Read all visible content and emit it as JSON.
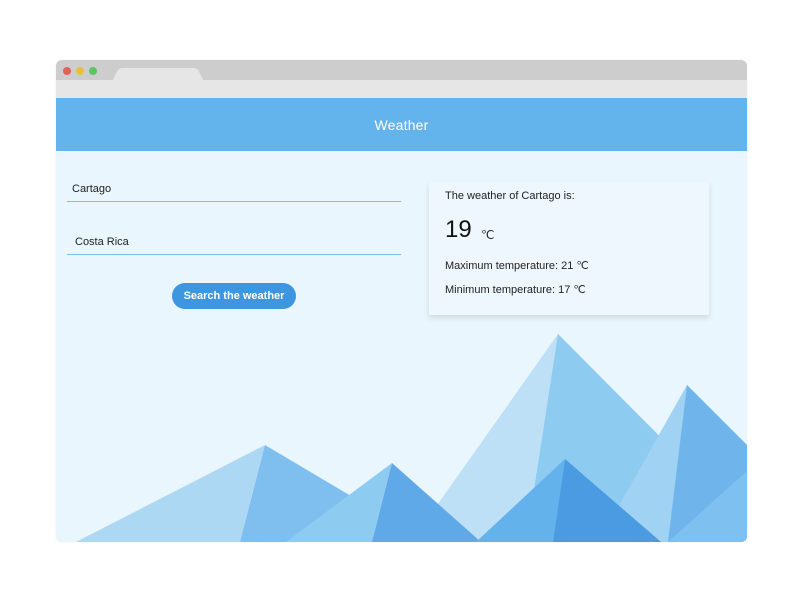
{
  "app": {
    "title": "Weather"
  },
  "form": {
    "city_value": "Cartago",
    "country_value": "Costa Rica",
    "search_label": "Search the weather"
  },
  "result": {
    "heading": "The weather of Cartago is:",
    "temperature": "19",
    "unit": "℃",
    "max": "Maximum temperature: 21 ℃",
    "min": "Minimum temperature: 17 ℃"
  },
  "colors": {
    "header": "#63b3ec",
    "button": "#3d96df",
    "background": "#eaf6fd",
    "mountain_light": "#bde0f6",
    "mountain_mid": "#8ecbf1",
    "mountain_dark": "#4a9be1"
  }
}
